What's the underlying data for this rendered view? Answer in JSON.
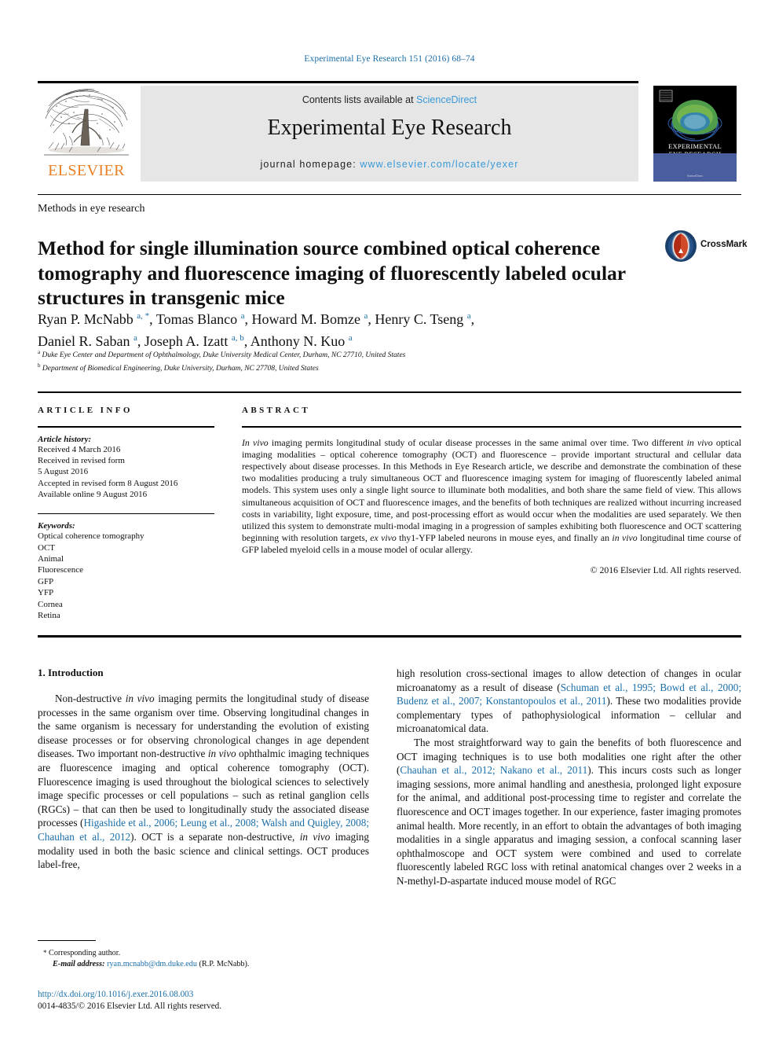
{
  "running_head": "Experimental Eye Research 151 (2016) 68–74",
  "masthead": {
    "contents_prefix": "Contents lists available at ",
    "sciencedirect": "ScienceDirect",
    "journal_title": "Experimental Eye Research",
    "homepage_prefix": "journal homepage: ",
    "homepage_url": "www.elsevier.com/locate/yexer",
    "elsevier_wordmark": "ELSEVIER",
    "cover_title_line1": "EXPERIMENTAL",
    "cover_title_line2": "EYE RESEARCH",
    "cover_footer": "ScienceDirect"
  },
  "article": {
    "section_type": "Methods in eye research",
    "title": "Method for single illumination source combined optical coherence tomography and fluorescence imaging of fluorescently labeled ocular structures in transgenic mice",
    "crossmark_label": "CrossMark",
    "authors_line1": "Ryan P. McNabb <sup>a, *</sup>, Tomas Blanco <sup>a</sup>, Howard M. Bomze <sup>a</sup>, Henry C. Tseng <sup>a</sup>,",
    "authors_line2": "Daniel R. Saban <sup>a</sup>, Joseph A. Izatt <sup>a, b</sup>, Anthony N. Kuo <sup>a</sup>",
    "affiliation_a": "Duke Eye Center and Department of Ophthalmology, Duke University Medical Center, Durham, NC 27710, United States",
    "affiliation_b": "Department of Biomedical Engineering, Duke University, Durham, NC 27708, United States"
  },
  "article_info": {
    "heading": "ARTICLE INFO",
    "history_label": "Article history:",
    "history": [
      "Received 4 March 2016",
      "Received in revised form",
      "5 August 2016",
      "Accepted in revised form 8 August 2016",
      "Available online 9 August 2016"
    ],
    "keywords_label": "Keywords:",
    "keywords": [
      "Optical coherence tomography",
      "OCT",
      "Animal",
      "Fluorescence",
      "GFP",
      "YFP",
      "Cornea",
      "Retina"
    ]
  },
  "abstract": {
    "heading": "ABSTRACT",
    "body_html": "<em class=\"it\">In vivo</em> imaging permits longitudinal study of ocular disease processes in the same animal over time. Two different <em class=\"it\">in vivo</em> optical imaging modalities &#8211; optical coherence tomography (OCT) and fluorescence &#8211; provide important structural and cellular data respectively about disease processes. In this Methods in Eye Research article, we describe and demonstrate the combination of these two modalities producing a truly simultaneous OCT and fluorescence imaging system for imaging of fluorescently labeled animal models. This system uses only a single light source to illuminate both modalities, and both share the same field of view. This allows simultaneous acquisition of OCT and fluorescence images, and the benefits of both techniques are realized without incurring increased costs in variability, light exposure, time, and post-processing effort as would occur when the modalities are used separately. We then utilized this system to demonstrate multi-modal imaging in a progression of samples exhibiting both fluorescence and OCT scattering beginning with resolution targets, <em class=\"it\">ex vivo</em> thy1-YFP labeled neurons in mouse eyes, and finally an <em class=\"it\">in vivo</em> longitudinal time course of GFP labeled myeloid cells in a mouse model of ocular allergy.",
    "copyright": "© 2016 Elsevier Ltd. All rights reserved."
  },
  "introduction": {
    "heading": "1. Introduction",
    "left_paragraph_html": "Non-destructive <em class=\"it\">in vivo</em> imaging permits the longitudinal study of disease processes in the same organism over time. Observing longitudinal changes in the same organism is necessary for understanding the evolution of existing disease processes or for observing chronological changes in age dependent diseases. Two important non-destructive <em class=\"it\">in vivo</em> ophthalmic imaging techniques are fluorescence imaging and optical coherence tomography (OCT). Fluorescence imaging is used throughout the biological sciences to selectively image specific processes or cell populations &#8211; such as retinal ganglion cells (RGCs) &#8211; that can then be used to longitudinally study the associated disease processes (<span class=\"cite\">Higashide et al., 2006; Leung et al., 2008; Walsh and Quigley, 2008; Chauhan et al., 2012</span>). OCT is a separate non-destructive, <em class=\"it\">in vivo</em> imaging modality used in both the basic science and clinical settings. OCT produces label-free,",
    "right_paragraph1_html": "high resolution cross-sectional images to allow detection of changes in ocular microanatomy as a result of disease (<span class=\"cite\">Schuman et al., 1995; Bowd et al., 2000; Budenz et al., 2007; Konstantopoulos et al., 2011</span>). These two modalities provide complementary types of pathophysiological information &#8211; cellular and microanatomical data.",
    "right_paragraph2_html": "The most straightforward way to gain the benefits of both fluorescence and OCT imaging techniques is to use both modalities one right after the other (<span class=\"cite\">Chauhan et al., 2012; Nakano et al., 2011</span>). This incurs costs such as longer imaging sessions, more animal handling and anesthesia, prolonged light exposure for the animal, and additional post-processing time to register and correlate the fluorescence and OCT images together. In our experience, faster imaging promotes animal health. More recently, in an effort to obtain the advantages of both imaging modalities in a single apparatus and imaging session, a confocal scanning laser ophthalmoscope and OCT system were combined and used to correlate fluorescently labeled RGC loss with retinal anatomical changes over 2 weeks in a N-methyl-D-aspartate induced mouse model of RGC"
  },
  "footer": {
    "corresponding_marker": "*",
    "corresponding_label": "Corresponding author.",
    "email_label": "E-mail address:",
    "email": "ryan.mcnabb@dm.duke.edu",
    "email_suffix": "(R.P. McNabb).",
    "doi_url": "http://dx.doi.org/10.1016/j.exer.2016.08.003",
    "issn_line": "0014-4835/© 2016 Elsevier Ltd. All rights reserved."
  },
  "colors": {
    "link_blue": "#1a6ea8",
    "sciencedirect_blue": "#3a9ad9",
    "elsevier_orange": "#ea8025",
    "band_gray": "#e6e6e6"
  }
}
